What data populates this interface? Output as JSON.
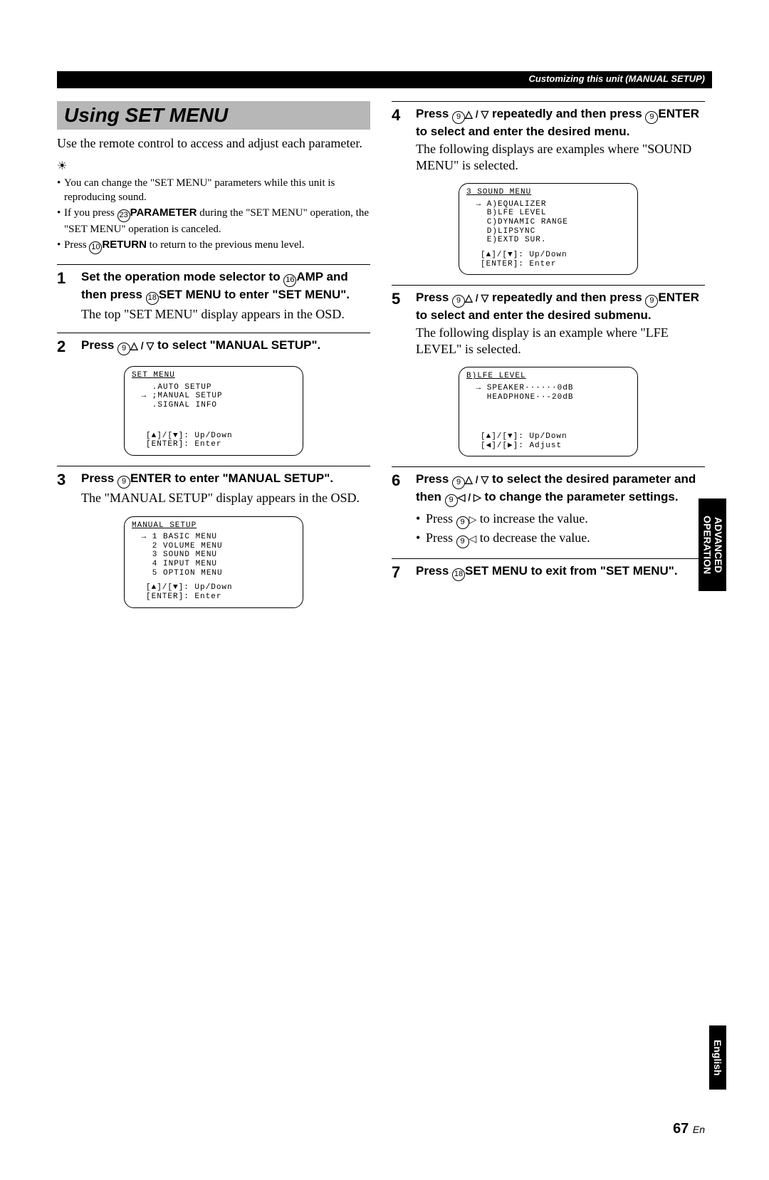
{
  "header": {
    "breadcrumb": "Customizing this unit (MANUAL SETUP)"
  },
  "section_title": "Using SET MENU",
  "intro": "Use the remote control to access and adjust each parameter.",
  "notes": {
    "n1": "You can change the \"SET MENU\" parameters while this unit is reproducing sound.",
    "n2a": "If you press ",
    "n2_ref": "23",
    "n2_btn": "PARAMETER",
    "n2b": " during the \"SET MENU\" operation, the \"SET MENU\" operation is canceled.",
    "n3a": "Press ",
    "n3_ref": "10",
    "n3_btn": "RETURN",
    "n3b": " to return to the previous menu level."
  },
  "step1": {
    "h_a": "Set the operation mode selector to ",
    "ref1": "16",
    "btn1": "AMP",
    "h_b": " and then press ",
    "ref2": "18",
    "btn2": "SET MENU",
    "h_c": " to enter \"SET MENU\".",
    "desc": "The top \"SET MENU\" display appears in the OSD."
  },
  "step2": {
    "h_a": "Press ",
    "ref": "9",
    "arrows": "△ / ▽",
    "h_b": " to select \"MANUAL SETUP\"."
  },
  "lcd1": {
    "title": "SET MENU",
    "r1": "   .AUTO SETUP",
    "r2": " → ;MANUAL SETUP",
    "r3": "   .SIGNAL INFO",
    "f1": "[▲]/[▼]: Up/Down",
    "f2": "[ENTER]: Enter"
  },
  "step3": {
    "h_a": "Press ",
    "ref": "9",
    "btn": "ENTER",
    "h_b": " to enter \"MANUAL SETUP\".",
    "desc": "The \"MANUAL SETUP\" display appears in the OSD."
  },
  "lcd2": {
    "title": "MANUAL SETUP",
    "r1": " → 1 BASIC MENU",
    "r2": "   2 VOLUME MENU",
    "r3": "   3 SOUND MENU",
    "r4": "   4 INPUT MENU",
    "r5": "   5 OPTION MENU",
    "f1": "[▲]/[▼]: Up/Down",
    "f2": "[ENTER]: Enter"
  },
  "step4": {
    "h_a": "Press ",
    "ref": "9",
    "arrows": "△ / ▽",
    "h_b": " repeatedly and then press ",
    "ref2": "9",
    "btn": "ENTER",
    "h_c": " to select and enter the desired menu.",
    "desc": "The following displays are examples where \"SOUND MENU\" is selected."
  },
  "lcd3": {
    "title": "3 SOUND MENU",
    "r1": " → A)EQUALIZER",
    "r2": "   B)LFE LEVEL",
    "r3": "   C)DYNAMIC RANGE",
    "r4": "   D)LIPSYNC",
    "r5": "   E)EXTD SUR.",
    "f1": "[▲]/[▼]: Up/Down",
    "f2": "[ENTER]: Enter"
  },
  "step5": {
    "h_a": "Press ",
    "ref": "9",
    "arrows": "△ / ▽",
    "h_b": " repeatedly and then press ",
    "ref2": "9",
    "btn": "ENTER",
    "h_c": " to select and enter the desired submenu.",
    "desc": "The following display is an example where \"LFE LEVEL\" is selected."
  },
  "lcd4": {
    "title": "B)LFE LEVEL",
    "r1": " → SPEAKER······0dB",
    "r2": "   HEADPHONE··-20dB",
    "f1": "[▲]/[▼]: Up/Down",
    "f2": "[◀]/[▶]: Adjust"
  },
  "step6": {
    "h_a": "Press ",
    "ref": "9",
    "arrows": "△ / ▽",
    "h_b": " to select the desired parameter and then ",
    "ref2": "9",
    "arrows2": "◁ / ▷",
    "h_c": " to change the parameter settings.",
    "b1a": "Press ",
    "b1_ref": "9",
    "b1_arrow": "▷",
    "b1b": " to increase the value.",
    "b2a": "Press ",
    "b2_ref": "9",
    "b2_arrow": "◁",
    "b2b": " to decrease the value."
  },
  "step7": {
    "h_a": "Press ",
    "ref": "18",
    "btn": "SET MENU",
    "h_b": " to exit from \"SET MENU\"."
  },
  "side": {
    "tab1": "ADVANCED OPERATION",
    "tab2": "English"
  },
  "page_num": "67",
  "page_lang": "En"
}
